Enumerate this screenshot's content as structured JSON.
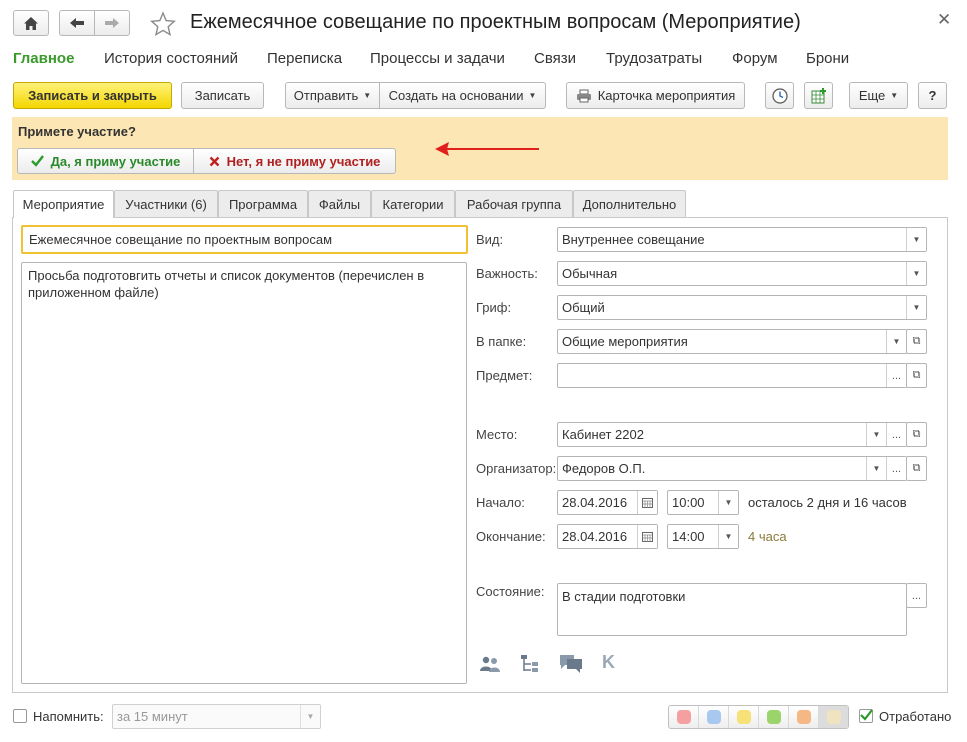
{
  "window": {
    "title": "Ежемесячное совещание по проектным вопросам (Мероприятие)"
  },
  "nav": {
    "items": [
      {
        "label": "Главное",
        "active": true
      },
      {
        "label": "История состояний"
      },
      {
        "label": "Переписка"
      },
      {
        "label": "Процессы и задачи"
      },
      {
        "label": "Связи"
      },
      {
        "label": "Трудозатраты"
      },
      {
        "label": "Форум"
      },
      {
        "label": "Брони"
      }
    ]
  },
  "toolbar": {
    "save_close": "Записать и закрыть",
    "save": "Записать",
    "send": "Отправить",
    "create_based": "Создать на основании",
    "event_card": "Карточка мероприятия",
    "more": "Еще",
    "help": "?"
  },
  "participation": {
    "question": "Примете участие?",
    "yes": "Да, я приму участие",
    "no": "Нет, я не приму участие",
    "arrow_color": "#e0201c"
  },
  "tabs": [
    {
      "label": "Мероприятие",
      "active": true
    },
    {
      "label": "Участники (6)"
    },
    {
      "label": "Программа"
    },
    {
      "label": "Файлы"
    },
    {
      "label": "Категории"
    },
    {
      "label": "Рабочая группа"
    },
    {
      "label": "Дополнительно"
    }
  ],
  "left": {
    "subject": "Ежемесячное совещание по проектным вопросам",
    "description": "Просьба подготовгить отчеты и список документов (перечислен в приложенном файле)"
  },
  "form": {
    "vid_label": "Вид:",
    "vid_value": "Внутреннее совещание",
    "importance_label": "Важность:",
    "importance_value": "Обычная",
    "grif_label": "Гриф:",
    "grif_value": "Общий",
    "folder_label": "В папке:",
    "folder_value": "Общие мероприятия",
    "subject_label": "Предмет:",
    "subject_value": "",
    "place_label": "Место:",
    "place_value": "Кабинет 2202",
    "organizer_label": "Организатор:",
    "organizer_value": "Федоров О.П.",
    "start_label": "Начало:",
    "start_date": "28.04.2016",
    "start_time": "10:00",
    "remaining": "осталось 2 дня и 16 часов",
    "end_label": "Окончание:",
    "end_date": "28.04.2016",
    "end_time": "14:00",
    "duration": "4 часа",
    "state_label": "Состояние:",
    "state_value": "В стадии подготовки",
    "ellipsis": "..."
  },
  "footer": {
    "remind_label": "Напомнить:",
    "remind_value": "за 15 минут",
    "done_label": "Отработано",
    "done_checked": true,
    "colors": [
      "#f4a0a0",
      "#a8c8f0",
      "#f7e27a",
      "#9ad46a",
      "#f5b884",
      "#efe3c0"
    ]
  },
  "icons": {
    "home": "home-icon",
    "back": "arrow-left-icon",
    "forward": "arrow-right-icon",
    "star": "star-icon",
    "close": "close-icon",
    "printer": "printer-icon",
    "clock": "clock-icon",
    "spreadsheet": "spreadsheet-add-icon",
    "check": "check-icon",
    "cross": "cross-icon",
    "users": "users-icon",
    "tree": "tree-icon",
    "chat": "chat-icon",
    "k": "k-icon",
    "calendar": "calendar-icon"
  }
}
